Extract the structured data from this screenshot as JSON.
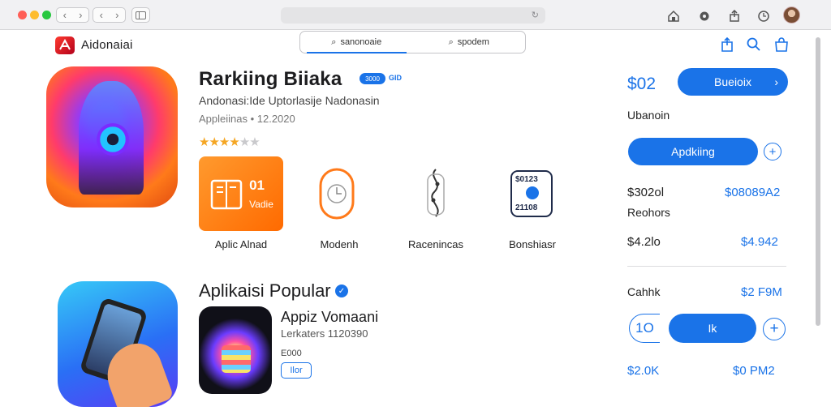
{
  "colors": {
    "accent": "#1a73e8",
    "close": "#ff5f57",
    "minimize": "#febc2e",
    "zoom": "#28c840"
  },
  "brand": {
    "name": "Aidonaiai",
    "icon": "app-store-logo"
  },
  "tabs": [
    {
      "label": "sanonoaie",
      "icon": "search-icon",
      "active": true
    },
    {
      "label": "spodem",
      "icon": "search-icon",
      "active": false
    }
  ],
  "app": {
    "title": "Rarkiing Biiaka",
    "badge1": "3000",
    "badge2": "GID",
    "subtitle": "Andonasi:Ide Uptorlasije Nadonasin",
    "meta": "Appleiinas • 12.2020",
    "rating": 3.5
  },
  "features": [
    {
      "label": "Aplic Alnad",
      "tile_text_1": "01",
      "tile_text_2": "Vadie",
      "icon": "book-icon"
    },
    {
      "label": "Modenh",
      "icon": "clock-icon"
    },
    {
      "label": "Racenincas",
      "icon": "pendant-icon"
    },
    {
      "label": "Bonshiasr",
      "icon": "grid-icon",
      "tile_text_1": "$0123",
      "tile_text_2": "21108"
    }
  ],
  "sidebar": {
    "price": "$02",
    "buy_label": "Bueioix",
    "uba_label": "Ubanoin",
    "apply_label": "Apdkiing",
    "row1_left": "$302ol",
    "row1_right": "$08089A2",
    "rechors_label": "Reohors",
    "row2_left": "$4.2lo",
    "row2_right": "$4.942",
    "row3_left": "Cahhk",
    "row3_right": "$2 F9M",
    "outline_value": "1O",
    "ok_label": "Ik",
    "row4_left": "$2.0K",
    "row4_right": "$0 PM2"
  },
  "popular": {
    "title": "Aplikaisi Popular",
    "app_name": "Appiz Vomaani",
    "app_meta": "Lerkaters 1120390",
    "app_size": "E000",
    "app_button": "Ilor"
  }
}
